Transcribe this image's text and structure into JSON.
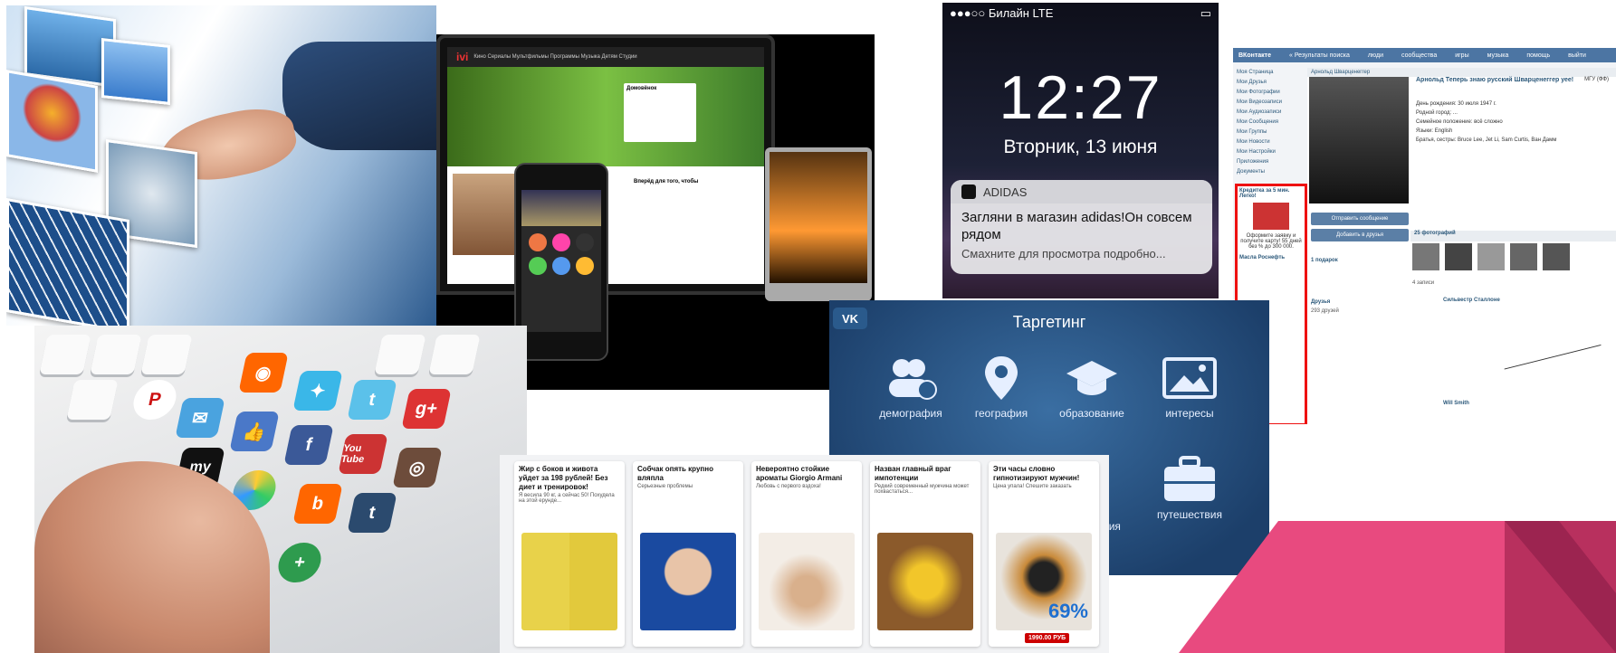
{
  "lockscreen": {
    "carrier": "●●●○○ Билайн  LTE",
    "time": "12:27",
    "date": "Вторник, 13 июня",
    "notification": {
      "app": "ADIDAS",
      "message": "Загляни в магазин adidas!Он совсем рядом",
      "hint": "Смахните для просмотра подробно..."
    }
  },
  "devices": {
    "brand": "ivi",
    "nav": "Кино  Сериалы  Мультфильмы  Программы  Музыка  Детям  Студии",
    "hero_card_title": "Домовёнок",
    "sidebar_title": "Вперёд для того, чтобы"
  },
  "vk": {
    "logo": "ВКонтакте",
    "topnav": [
      "« Результаты поиска",
      "люди",
      "сообщества",
      "игры",
      "музыка",
      "помощь",
      "выйти"
    ],
    "menu": [
      "Моя Страница",
      "Мои Друзья",
      "Мои Фотографии",
      "Мои Видеозаписи",
      "Мои Аудиозаписи",
      "Мои Сообщения",
      "Мои Группы",
      "Мои Новости",
      "Мои Настройки",
      "Приложения",
      "Документы"
    ],
    "section_title": "Арнольд Шварценеггер",
    "name": "Арнольд Теперь знаю русский Шварценеггер",
    "status": "уее!",
    "university": "МГУ (ФФ)",
    "info": [
      "День рождения: 30 июля 1947 г.",
      "Родной город: ...",
      "Семейное положение: всё сложно",
      "Языки: English",
      "Братья, сестры: Bruce Lee, Jet Li, Sam Curtis, Ван Дамм"
    ],
    "buttons": [
      "Отправить сообщение",
      "Добавить в друзья"
    ],
    "ad_title": "Кредитка за 5 мин. Легко!",
    "ad_text": "Оформите заявку и получите карту! 55 дней без % до 300 000.",
    "ad2_title": "Масла Роснефть",
    "photos_label": "25 фотографий",
    "gifts_label": "1 подарок",
    "friends_label": "Друзья",
    "friends_count": "293 друзей",
    "post_author": "Сильвестр Сталлоне",
    "post_author2": "Will Smith",
    "records": "4 записи"
  },
  "targeting": {
    "title": "Таргетинг",
    "logo": "VK",
    "items": [
      "демография",
      "география",
      "образование",
      "интересы",
      "ния",
      "путешествия"
    ]
  },
  "ads": [
    {
      "title": "Жир с боков и живота уйдет за 198 рублей! Без диет и тренировок!",
      "sub": "Я весила 90 кг, а сейчас 50! Похудела на этой ерунде..."
    },
    {
      "title": "Собчак опять крупно вляпла",
      "sub": "Серьезные проблемы"
    },
    {
      "title": "Невероятно стойкие ароматы Giorgio Armani",
      "sub": "Любовь с первого вздоха!"
    },
    {
      "title": "Назван главный враг импотенции",
      "sub": "Редкий современный мужчина может похвастаться..."
    },
    {
      "title": "Эти часы словно гипнотизируют мужчин!",
      "sub": "Цена упала! Спешите заказать",
      "price": "1990.00 РУБ",
      "discount": "69%"
    }
  ],
  "keyboard": {
    "keys": [
      "my",
      "You Tube",
      "g+",
      "f",
      "t",
      "b"
    ]
  },
  "colors": {
    "vk_blue": "#4c75a3",
    "pink": "#e84a7f",
    "ad_red": "#cc0000"
  }
}
